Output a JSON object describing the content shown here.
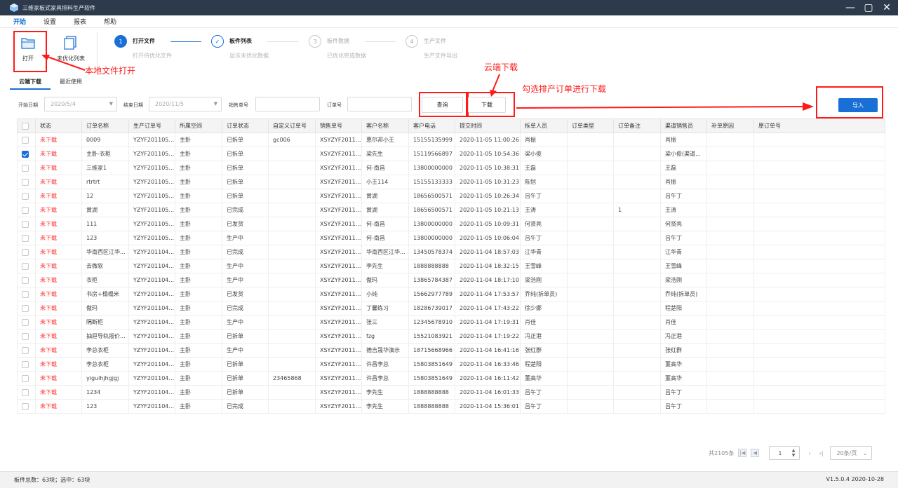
{
  "titlebar": {
    "title": "三维家板式家具排料生产软件"
  },
  "menu": [
    "开始",
    "设置",
    "报表",
    "帮助"
  ],
  "toolbar": {
    "open_label": "打开",
    "unopt_label": "未优化列表"
  },
  "steps": [
    {
      "num": "1",
      "title": "打开文件",
      "sub": "打开待优化文件"
    },
    {
      "num": "",
      "title": "板件列表",
      "sub": "显示未优化数据"
    },
    {
      "num": "3",
      "title": "板件数据",
      "sub": "已优化完成数据"
    },
    {
      "num": "4",
      "title": "生产文件",
      "sub": "生产文件导出"
    }
  ],
  "annotations": {
    "local_open": "本地文件打开",
    "cloud_download": "云端下载",
    "select_download": "勾选排产订单进行下载"
  },
  "tabs": [
    "云端下载",
    "最近使用"
  ],
  "filters": {
    "start_label": "开始日期",
    "start_value": "2020/5/4",
    "end_label": "结束日期",
    "end_value": "2020/11/5",
    "sales_label": "销售单号",
    "order_label": "订单号",
    "query_btn": "查询",
    "download_btn": "下载",
    "import_btn": "导入"
  },
  "columns": [
    "状态",
    "订单名称",
    "生产订单号",
    "所属空间",
    "订单状态",
    "自定义订单号",
    "销售单号",
    "客户名称",
    "客户电话",
    "提交时间",
    "拆单人员",
    "订单类型",
    "订单备注",
    "渠道销售员",
    "补单原因",
    "原订单号"
  ],
  "rows": [
    {
      "checked": false,
      "cells": [
        "未下载",
        "0009",
        "YZYF201105...",
        "主卧",
        "已拆单",
        "gc006",
        "XSYZYF2011...",
        "惠尔邦小王",
        "15155135999",
        "2020-11-05 11:00:26",
        "肖振",
        "",
        "",
        "肖振",
        "",
        ""
      ]
    },
    {
      "checked": true,
      "cells": [
        "未下载",
        "主卧-衣柜",
        "YZYF201105...",
        "主卧",
        "已拆单",
        "",
        "XSYZYF2011...",
        "梁先生",
        "15119566897",
        "2020-11-05 10:54:36",
        "梁小俊",
        "",
        "",
        "梁小俊(渠道...",
        "",
        ""
      ]
    },
    {
      "checked": false,
      "cells": [
        "未下载",
        "三维家1",
        "YZYF201105...",
        "主卧",
        "已拆单",
        "",
        "XSYZYF2011...",
        "何-南昌",
        "13800000000",
        "2020-11-05 10:38:31",
        "王磊",
        "",
        "",
        "王磊",
        "",
        ""
      ]
    },
    {
      "checked": false,
      "cells": [
        "未下载",
        "rtrtrt",
        "YZYF201105...",
        "主卧",
        "已拆单",
        "",
        "XSYZYF2011...",
        "小王114",
        "15155133333",
        "2020-11-05 10:31:23",
        "陈恺",
        "",
        "",
        "肖振",
        "",
        ""
      ]
    },
    {
      "checked": false,
      "cells": [
        "未下载",
        "12",
        "YZYF201105...",
        "主卧",
        "已拆单",
        "",
        "XSYZYF2011...",
        "黄湖",
        "18656500571",
        "2020-11-05 10:26:34",
        "吕午丁",
        "",
        "",
        "吕午丁",
        "",
        ""
      ]
    },
    {
      "checked": false,
      "cells": [
        "未下载",
        "黄湖",
        "YZYF201105...",
        "主卧",
        "已完成",
        "",
        "XSYZYF2011...",
        "黄湖",
        "18656500571",
        "2020-11-05 10:21:13",
        "王涛",
        "",
        "1",
        "王涛",
        "",
        ""
      ]
    },
    {
      "checked": false,
      "cells": [
        "未下载",
        "111",
        "YZYF201105...",
        "主卧",
        "已发货",
        "",
        "XSYZYF2011...",
        "何-南昌",
        "13800000000",
        "2020-11-05 10:09:31",
        "何贤亮",
        "",
        "",
        "何贤亮",
        "",
        ""
      ]
    },
    {
      "checked": false,
      "cells": [
        "未下载",
        "123",
        "YZYF201105...",
        "主卧",
        "生产中",
        "",
        "XSYZYF2011...",
        "何-南昌",
        "13800000000",
        "2020-11-05 10:06:04",
        "吕午丁",
        "",
        "",
        "吕午丁",
        "",
        ""
      ]
    },
    {
      "checked": false,
      "cells": [
        "未下载",
        "华南西区江华...",
        "YZYF201104...",
        "主卧",
        "已完成",
        "",
        "XSYZYF2011...",
        "华南西区江华...",
        "13450578374",
        "2020-11-04 18:57:03",
        "江华青",
        "",
        "",
        "江华青",
        "",
        ""
      ]
    },
    {
      "checked": false,
      "cells": [
        "未下载",
        "去微软",
        "YZYF201104...",
        "主卧",
        "生产中",
        "",
        "XSYZYF2011...",
        "李先生",
        "1888888888",
        "2020-11-04 18:32:15",
        "王雪峰",
        "",
        "",
        "王雪峰",
        "",
        ""
      ]
    },
    {
      "checked": false,
      "cells": [
        "未下载",
        "衣柜",
        "YZYF201104...",
        "主卧",
        "生产中",
        "",
        "XSYZYF2011...",
        "傲玛",
        "13865784387",
        "2020-11-04 18:17:10",
        "梁浩刚",
        "",
        "",
        "梁浩刚",
        "",
        ""
      ]
    },
    {
      "checked": false,
      "cells": [
        "未下载",
        "书房+榻榻米",
        "YZYF201104...",
        "主卧",
        "已发货",
        "",
        "XSYZYF2011...",
        "小纯",
        "15662977789",
        "2020-11-04 17:53:57",
        "乔纯(拆单员)",
        "",
        "",
        "乔纯(拆单员)",
        "",
        ""
      ]
    },
    {
      "checked": false,
      "cells": [
        "未下载",
        "傲玛",
        "YZYF201104...",
        "主卧",
        "已完成",
        "",
        "XSYZYF2011...",
        "丁馨练习",
        "18286739017",
        "2020-11-04 17:43:22",
        "徐少娜",
        "",
        "",
        "程楚阳",
        "",
        ""
      ]
    },
    {
      "checked": false,
      "cells": [
        "未下载",
        "隔断柜",
        "YZYF201104...",
        "主卧",
        "生产中",
        "",
        "XSYZYF2011...",
        "张三",
        "12345678910",
        "2020-11-04 17:19:31",
        "肖佳",
        "",
        "",
        "肖佳",
        "",
        ""
      ]
    },
    {
      "checked": false,
      "cells": [
        "未下载",
        "抽屉导轨报价...",
        "YZYF201104...",
        "主卧",
        "已拆单",
        "",
        "XSYZYF2011...",
        "fzg",
        "15521083921",
        "2020-11-04 17:19:22",
        "冯正港",
        "",
        "",
        "冯正港",
        "",
        ""
      ]
    },
    {
      "checked": false,
      "cells": [
        "未下载",
        "李总衣柜",
        "YZYF201104...",
        "主卧",
        "生产中",
        "",
        "XSYZYF2011...",
        "德吉晟华演示",
        "18715668966",
        "2020-11-04 16:41:16",
        "张红群",
        "",
        "",
        "张红群",
        "",
        ""
      ]
    },
    {
      "checked": false,
      "cells": [
        "未下载",
        "李总衣柜",
        "YZYF201104...",
        "主卧",
        "已拆单",
        "",
        "XSYZYF2011...",
        "许昌李总",
        "15803851649",
        "2020-11-04 16:33:46",
        "程楚阳",
        "",
        "",
        "董高华",
        "",
        ""
      ]
    },
    {
      "checked": false,
      "cells": [
        "未下载",
        "yiguihjhgjgj",
        "YZYF201104...",
        "主卧",
        "已拆单",
        "23465868",
        "XSYZYF2011...",
        "许昌李总",
        "15803851649",
        "2020-11-04 16:11:42",
        "董高华",
        "",
        "",
        "董高华",
        "",
        ""
      ]
    },
    {
      "checked": false,
      "cells": [
        "未下载",
        "1234",
        "YZYF201104...",
        "主卧",
        "已拆单",
        "",
        "XSYZYF2011...",
        "李先生",
        "1888888888",
        "2020-11-04 16:01:33",
        "吕午丁",
        "",
        "",
        "吕午丁",
        "",
        ""
      ]
    },
    {
      "checked": false,
      "cells": [
        "未下载",
        "123",
        "YZYF201104...",
        "主卧",
        "已完成",
        "",
        "XSYZYF2011...",
        "李先生",
        "1888888888",
        "2020-11-04 15:36:01",
        "吕午丁",
        "",
        "",
        "吕午丁",
        "",
        ""
      ]
    }
  ],
  "pager": {
    "total": "共2105条",
    "page": "1",
    "size": "20条/页"
  },
  "statusbar": {
    "left": "板件总数：63块；选中：63块",
    "right": "V1.5.0.4 2020-10-28"
  },
  "colors": {
    "accent": "#1a6fd6",
    "annotation": "#ff1a1a",
    "titlebar": "#2d3a4b"
  }
}
